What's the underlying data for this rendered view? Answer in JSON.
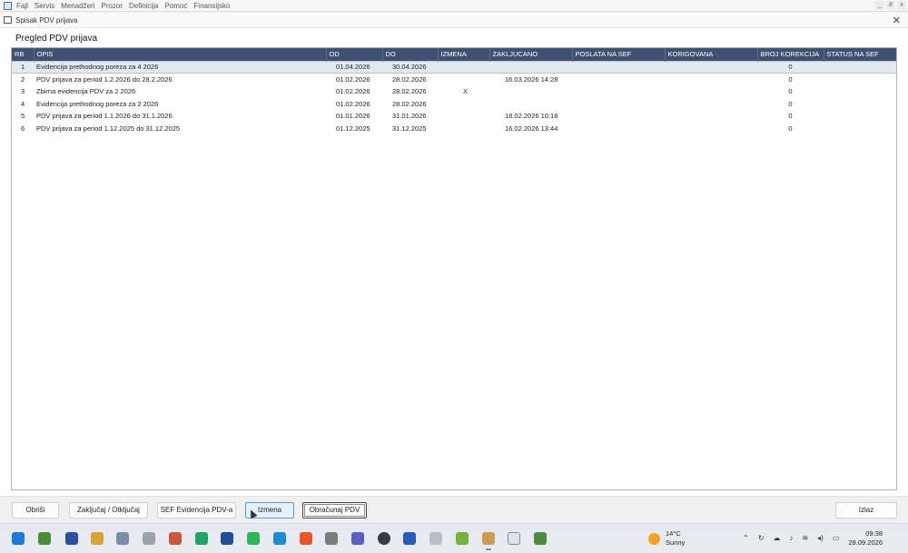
{
  "menubar": {
    "items": [
      "Fajl",
      "Servis",
      "Menadžeri",
      "Prozor",
      "Definicija",
      "Pomoć",
      "Finansijsko"
    ],
    "window_controls": [
      "_",
      "#",
      "x"
    ]
  },
  "window": {
    "title": "Spisak PDV prijava",
    "close_glyph": "✕"
  },
  "main": {
    "heading": "Pregled PDV prijava",
    "table": {
      "columns": [
        "RB",
        "OPIS",
        "OD",
        "DO",
        "IZMENA",
        "ZAKLJUCANO",
        "POSLATA NA SEF",
        "KORIGOVANA",
        "BROJ KOREKCIJA",
        "STATUS NA SEF"
      ],
      "rows": [
        {
          "rb": "1",
          "opis": "Evidencija prethodnog poreza za 4 2026",
          "od": "01.04.2026",
          "do": "30.04.2026",
          "izmena": "",
          "zakljucano": "",
          "poslata": "",
          "korigovana": "",
          "broj": "0",
          "status": ""
        },
        {
          "rb": "2",
          "opis": "PDV prijava za period 1.2.2026 do 28.2.2026",
          "od": "01.02.2026",
          "do": "28.02.2026",
          "izmena": "",
          "zakljucano": "16.03.2026 14:28",
          "poslata": "",
          "korigovana": "",
          "broj": "0",
          "status": ""
        },
        {
          "rb": "3",
          "opis": "Zbirna evidencija PDV za 2 2026",
          "od": "01.02.2026",
          "do": "28.02.2026",
          "izmena": "X",
          "zakljucano": "",
          "poslata": "",
          "korigovana": "",
          "broj": "0",
          "status": ""
        },
        {
          "rb": "4",
          "opis": "Evidencija prethodnog poreza za 2 2026",
          "od": "01.02.2026",
          "do": "28.02.2026",
          "izmena": "",
          "zakljucano": "",
          "poslata": "",
          "korigovana": "",
          "broj": "0",
          "status": ""
        },
        {
          "rb": "5",
          "opis": "PDV prijava za period 1.1.2026 do 31.1.2026",
          "od": "01.01.2026",
          "do": "31.01.2026",
          "izmena": "",
          "zakljucano": "18.02.2026 10:18",
          "poslata": "",
          "korigovana": "",
          "broj": "0",
          "status": ""
        },
        {
          "rb": "6",
          "opis": "PDV prijava za period 1.12.2025 do 31.12.2025",
          "od": "01.12.2025",
          "do": "31.12.2025",
          "izmena": "",
          "zakljucano": "16.02.2026 13:44",
          "poslata": "",
          "korigovana": "",
          "broj": "0",
          "status": ""
        }
      ],
      "selected_row": 0
    }
  },
  "buttons": {
    "obrisi": "Obriši",
    "zakljucaj": "Zaključaj / Otključaj",
    "sef": "SEF Evidencija PDV-a",
    "izmena": "Izmena",
    "obracunaj": "Obračunaj PDV",
    "izlaz": "Izlaz"
  },
  "taskbar": {
    "weather_temp": "14°C",
    "weather_desc": "Sunny",
    "time": "09:38",
    "date": "28.09.2026",
    "colors": {
      "header_bg": "#3e5170",
      "selected_row": "#e4e8f1",
      "hover_button": "#e5f1fb"
    }
  }
}
